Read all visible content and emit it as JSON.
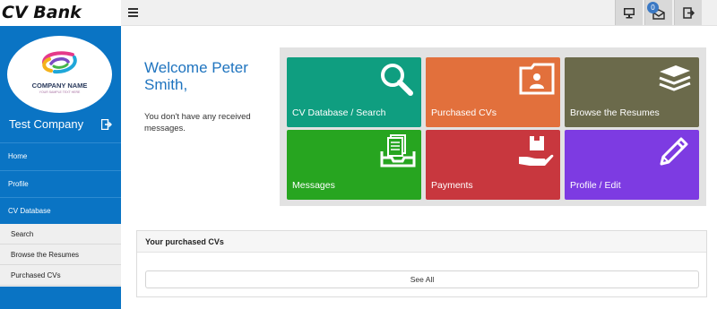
{
  "brand": "CV Bank",
  "topbar": {
    "notification_count": "0",
    "icons": [
      "monitor-icon",
      "mail-icon",
      "logout-icon"
    ]
  },
  "sidebar": {
    "logo": {
      "name": "COMPANY NAME",
      "tagline": "YOUR SAMPLE TEXT HERE"
    },
    "company": "Test Company",
    "items": [
      {
        "label": "Home"
      },
      {
        "label": "Profile"
      },
      {
        "label": "CV Database"
      }
    ],
    "subitems": [
      {
        "label": "Search"
      },
      {
        "label": "Browse the Resumes"
      },
      {
        "label": "Purchased CVs"
      }
    ]
  },
  "main": {
    "welcome": "Welcome Peter Smith,",
    "message": "You don't have any received messages.",
    "tiles": [
      {
        "label": "CV Database / Search",
        "color": "#0f9e80",
        "icon": "search-icon"
      },
      {
        "label": "Purchased CVs",
        "color": "#e2703c",
        "icon": "contact-folder-icon"
      },
      {
        "label": "Browse the Resumes",
        "color": "#6b6a4b",
        "icon": "stack-icon"
      },
      {
        "label": "Messages",
        "color": "#27a520",
        "icon": "inbox-icon"
      },
      {
        "label": "Payments",
        "color": "#c8373e",
        "icon": "payment-icon"
      },
      {
        "label": "Profile / Edit",
        "color": "#7d3be2",
        "icon": "pencil-icon"
      }
    ],
    "panel": {
      "title": "Your purchased CVs",
      "button": "See All"
    }
  }
}
